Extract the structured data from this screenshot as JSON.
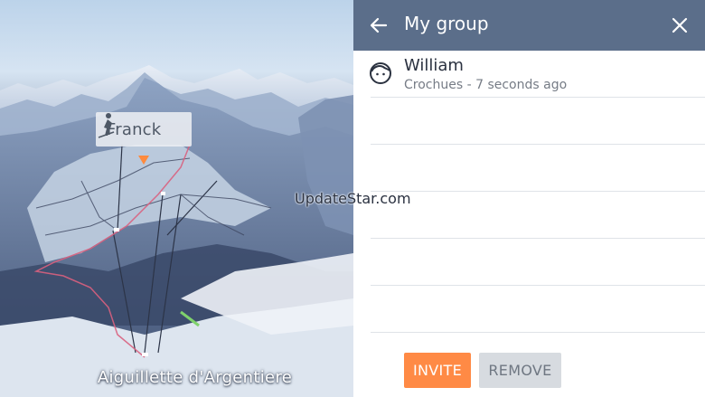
{
  "map": {
    "user_tag": {
      "name": "Franck",
      "icon": "skier-icon"
    },
    "place_label": "Aiguillette d'Argentiere",
    "route_color": "#d9607e",
    "pin_color": "#ff8a3d"
  },
  "watermark": "UpdateStar.com",
  "panel": {
    "header": {
      "title": "My group",
      "back_icon": "arrow-left-icon",
      "close_icon": "close-icon",
      "background": "#5b6e8a"
    },
    "members": [
      {
        "name": "William",
        "status": "Crochues - 7 seconds ago",
        "icon": "face-icon"
      }
    ],
    "empty_rows": 5,
    "buttons": {
      "invite_label": "INVITE",
      "remove_label": "REMOVE",
      "invite_color": "#ff8a45",
      "remove_color": "#d7dbe0"
    }
  }
}
